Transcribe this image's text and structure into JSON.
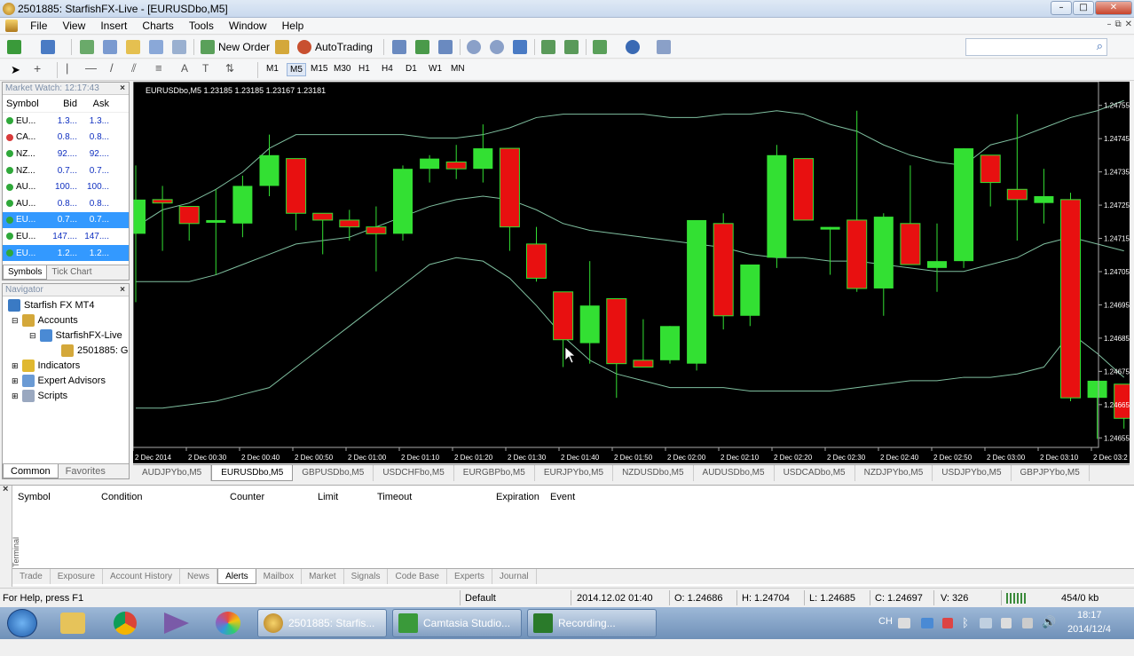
{
  "window": {
    "title": "2501885: StarfishFX-Live - [EURUSDbo,M5]",
    "min_glyph": "–",
    "max_glyph": "□",
    "close_glyph": "✕"
  },
  "menu": [
    "File",
    "View",
    "Insert",
    "Charts",
    "Tools",
    "Window",
    "Help"
  ],
  "doc_controls": [
    "–",
    "⧉",
    "✕"
  ],
  "toolbar": {
    "new_order": "New Order",
    "autotrading": "AutoTrading",
    "search_icon": "⌕"
  },
  "timeframes": [
    "M1",
    "M5",
    "M15",
    "M30",
    "H1",
    "H4",
    "D1",
    "W1",
    "MN"
  ],
  "market_watch": {
    "title": "Market Watch: 12:17:43",
    "close": "×",
    "headers": [
      "Symbol",
      "Bid",
      "Ask"
    ],
    "rows": [
      {
        "symbol": "EU...",
        "bid": "1.3...",
        "ask": "1.3...",
        "dir": "up"
      },
      {
        "symbol": "CA...",
        "bid": "0.8...",
        "ask": "0.8...",
        "dir": "down"
      },
      {
        "symbol": "NZ...",
        "bid": "92....",
        "ask": "92....",
        "dir": "up"
      },
      {
        "symbol": "NZ...",
        "bid": "0.7...",
        "ask": "0.7...",
        "dir": "up"
      },
      {
        "symbol": "AU...",
        "bid": "100...",
        "ask": "100...",
        "dir": "up"
      },
      {
        "symbol": "AU...",
        "bid": "0.8...",
        "ask": "0.8...",
        "dir": "up"
      },
      {
        "symbol": "EU...",
        "bid": "0.7...",
        "ask": "0.7...",
        "dir": "up",
        "sel": true
      },
      {
        "symbol": "EU...",
        "bid": "147....",
        "ask": "147....",
        "dir": "up"
      },
      {
        "symbol": "EU...",
        "bid": "1.2...",
        "ask": "1.2...",
        "dir": "up",
        "sel": true
      }
    ],
    "tabs": [
      "Symbols",
      "Tick Chart"
    ]
  },
  "navigator": {
    "title": "Navigator",
    "close": "×",
    "items": [
      "Starfish FX MT4",
      "Accounts",
      "StarfishFX-Live",
      "2501885: G",
      "Indicators",
      "Expert Advisors",
      "Scripts"
    ],
    "tabs": [
      "Common",
      "Favorites"
    ]
  },
  "chart": {
    "header": "EURUSDbo,M5  1.23185 1.23185 1.23167 1.23181",
    "price_labels": [
      "1.24755",
      "1.24745",
      "1.24735",
      "1.24725",
      "1.24715",
      "1.24705",
      "1.24695",
      "1.24685",
      "1.24675",
      "1.24665",
      "1.24655"
    ],
    "time_labels": [
      "2 Dec 2014",
      "2 Dec 00:30",
      "2 Dec 00:40",
      "2 Dec 00:50",
      "2 Dec 01:00",
      "2 Dec 01:10",
      "2 Dec 01:20",
      "2 Dec 01:30",
      "2 Dec 01:40",
      "2 Dec 01:50",
      "2 Dec 02:00",
      "2 Dec 02:10",
      "2 Dec 02:20",
      "2 Dec 02:30",
      "2 Dec 02:40",
      "2 Dec 02:50",
      "2 Dec 03:00",
      "2 Dec 03:10",
      "2 Dec 03:2"
    ],
    "bull_color": "#33e033",
    "bear_color": "#e81010",
    "band_color": "#7fbf9f"
  },
  "chart_data": {
    "type": "candlestick",
    "symbol": "EURUSDbo,M5",
    "ylim": [
      1.246525,
      1.247595
    ],
    "candles": [
      {
        "o": 1.24715,
        "h": 1.24735,
        "l": 1.24695,
        "c": 1.24725
      },
      {
        "o": 1.24725,
        "h": 1.24729,
        "l": 1.2471,
        "c": 1.24724
      },
      {
        "o": 1.24723,
        "h": 1.24723,
        "l": 1.24713,
        "c": 1.24718
      },
      {
        "o": 1.24719,
        "h": 1.24728,
        "l": 1.24703,
        "c": 1.24719
      },
      {
        "o": 1.24718,
        "h": 1.24732,
        "l": 1.24714,
        "c": 1.24729
      },
      {
        "o": 1.24729,
        "h": 1.24744,
        "l": 1.24726,
        "c": 1.24738
      },
      {
        "o": 1.24737,
        "h": 1.24737,
        "l": 1.24716,
        "c": 1.24721
      },
      {
        "o": 1.24721,
        "h": 1.24721,
        "l": 1.24709,
        "c": 1.24719
      },
      {
        "o": 1.24719,
        "h": 1.24722,
        "l": 1.24713,
        "c": 1.24717
      },
      {
        "o": 1.24717,
        "h": 1.24723,
        "l": 1.24704,
        "c": 1.24715
      },
      {
        "o": 1.24715,
        "h": 1.24735,
        "l": 1.24713,
        "c": 1.24734
      },
      {
        "o": 1.24734,
        "h": 1.24738,
        "l": 1.2473,
        "c": 1.24737
      },
      {
        "o": 1.24736,
        "h": 1.24741,
        "l": 1.24731,
        "c": 1.24734
      },
      {
        "o": 1.24734,
        "h": 1.24747,
        "l": 1.2473,
        "c": 1.2474
      },
      {
        "o": 1.2474,
        "h": 1.2474,
        "l": 1.2471,
        "c": 1.24717
      },
      {
        "o": 1.24712,
        "h": 1.24717,
        "l": 1.24701,
        "c": 1.24702
      },
      {
        "o": 1.24698,
        "h": 1.24698,
        "l": 1.24676,
        "c": 1.24684
      },
      {
        "o": 1.24683,
        "h": 1.24707,
        "l": 1.24677,
        "c": 1.24694
      },
      {
        "o": 1.24696,
        "h": 1.24696,
        "l": 1.24667,
        "c": 1.24677
      },
      {
        "o": 1.24678,
        "h": 1.2469,
        "l": 1.24676,
        "c": 1.24676
      },
      {
        "o": 1.24678,
        "h": 1.24688,
        "l": 1.24677,
        "c": 1.24688
      },
      {
        "o": 1.24677,
        "h": 1.24719,
        "l": 1.24675,
        "c": 1.24719
      },
      {
        "o": 1.24718,
        "h": 1.24721,
        "l": 1.24687,
        "c": 1.24691
      },
      {
        "o": 1.24691,
        "h": 1.24706,
        "l": 1.24688,
        "c": 1.24706
      },
      {
        "o": 1.24708,
        "h": 1.24741,
        "l": 1.24705,
        "c": 1.24738
      },
      {
        "o": 1.24737,
        "h": 1.24737,
        "l": 1.24719,
        "c": 1.24719
      },
      {
        "o": 1.24717,
        "h": 1.24717,
        "l": 1.24703,
        "c": 1.24717
      },
      {
        "o": 1.24719,
        "h": 1.24751,
        "l": 1.24698,
        "c": 1.24699
      },
      {
        "o": 1.24699,
        "h": 1.24721,
        "l": 1.24691,
        "c": 1.2472
      },
      {
        "o": 1.24718,
        "h": 1.24735,
        "l": 1.24706,
        "c": 1.24706
      },
      {
        "o": 1.24705,
        "h": 1.24718,
        "l": 1.24698,
        "c": 1.24707
      },
      {
        "o": 1.24707,
        "h": 1.2474,
        "l": 1.24705,
        "c": 1.2474
      },
      {
        "o": 1.24738,
        "h": 1.24738,
        "l": 1.24723,
        "c": 1.2473
      },
      {
        "o": 1.24728,
        "h": 1.2475,
        "l": 1.24713,
        "c": 1.24725
      },
      {
        "o": 1.24724,
        "h": 1.24734,
        "l": 1.24718,
        "c": 1.24726
      },
      {
        "o": 1.24725,
        "h": 1.24727,
        "l": 1.24666,
        "c": 1.24667
      },
      {
        "o": 1.24667,
        "h": 1.24671,
        "l": 1.24655,
        "c": 1.24672
      },
      {
        "o": 1.24671,
        "h": 1.24671,
        "l": 1.24658,
        "c": 1.24661
      }
    ],
    "upper_band": [
      1.24717,
      1.24722,
      1.24724,
      1.24728,
      1.24733,
      1.2474,
      1.24744,
      1.24744,
      1.24744,
      1.24744,
      1.24744,
      1.24743,
      1.24743,
      1.24744,
      1.24746,
      1.24749,
      1.2475,
      1.2475,
      1.2475,
      1.2475,
      1.24749,
      1.24749,
      1.2475,
      1.2475,
      1.24751,
      1.2475,
      1.24747,
      1.24745,
      1.24741,
      1.24738,
      1.24736,
      1.24735,
      1.24741,
      1.24743,
      1.24746,
      1.24749,
      1.24751,
      1.24754
    ],
    "middle_band": [
      1.24701,
      1.24701,
      1.24701,
      1.24703,
      1.24706,
      1.24709,
      1.24712,
      1.24713,
      1.24714,
      1.24717,
      1.2472,
      1.24723,
      1.24725,
      1.24726,
      1.24725,
      1.24722,
      1.24718,
      1.24716,
      1.24715,
      1.24714,
      1.24713,
      1.24712,
      1.24711,
      1.24709,
      1.24708,
      1.24708,
      1.24707,
      1.24707,
      1.24706,
      1.24705,
      1.24704,
      1.24704,
      1.24706,
      1.24708,
      1.24712,
      1.24714,
      1.24712,
      1.2471
    ],
    "lower_band": [
      1.24664,
      1.24664,
      1.24665,
      1.24666,
      1.24668,
      1.2467,
      1.24676,
      1.24682,
      1.24688,
      1.24694,
      1.247,
      1.24706,
      1.24708,
      1.24707,
      1.24702,
      1.24694,
      1.24685,
      1.24678,
      1.24674,
      1.24672,
      1.2467,
      1.2467,
      1.2467,
      1.24669,
      1.24669,
      1.24669,
      1.24669,
      1.2467,
      1.24671,
      1.24672,
      1.24672,
      1.24673,
      1.24673,
      1.24674,
      1.24676,
      1.24686,
      1.2468,
      1.24673
    ]
  },
  "chart_tabs": [
    "AUDJPYbo,M5",
    "EURUSDbo,M5",
    "GBPUSDbo,M5",
    "USDCHFbo,M5",
    "EURGBPbo,M5",
    "EURJPYbo,M5",
    "NZDUSDbo,M5",
    "AUDUSDbo,M5",
    "USDCADbo,M5",
    "NZDJPYbo,M5",
    "USDJPYbo,M5",
    "GBPJPYbo,M5"
  ],
  "terminal": {
    "headers": [
      "Symbol",
      "Condition",
      "Counter",
      "Limit",
      "Timeout",
      "Expiration",
      "Event"
    ],
    "side_label": "Terminal",
    "close": "×",
    "tabs": [
      "Trade",
      "Exposure",
      "Account History",
      "News",
      "Alerts",
      "Mailbox",
      "Market",
      "Signals",
      "Code Base",
      "Experts",
      "Journal"
    ]
  },
  "status": {
    "help": "For Help, press F1",
    "profile": "Default",
    "datetime": "2014.12.02 01:40",
    "open": "O: 1.24686",
    "high": "H: 1.24704",
    "low": "L: 1.24685",
    "close": "C: 1.24697",
    "volume": "V: 326",
    "traffic": "454/0 kb"
  },
  "taskbar": {
    "apps": [
      "2501885: Starfis...",
      "Camtasia Studio...",
      "Recording..."
    ],
    "lang": "CH",
    "time": "18:17",
    "date": "2014/12/4"
  }
}
